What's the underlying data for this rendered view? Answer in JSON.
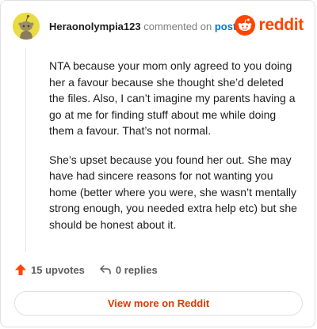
{
  "comment": {
    "username": "Heraonolympia123",
    "action_text": "commented on",
    "post_link": "post",
    "paragraphs": [
      "NTA because your mom only agreed to you doing her a favour because she thought she’d deleted the files. Also, I can’t imagine my parents having a go at me for finding stuff about me while doing them a favour. That’s not normal.",
      "She’s upset because you found her out. She may have had sincere reasons for not wanting you home (better where you were, she wasn’t mentally strong enough, you needed extra help etc) but she should be honest about it."
    ]
  },
  "brand": {
    "wordmark": "reddit",
    "color": "#ff4500"
  },
  "footer": {
    "upvotes": "15 upvotes",
    "replies": "0 replies",
    "upvote_icon": "upvote-arrow-icon",
    "reply_icon": "reply-arrow-icon"
  },
  "actions": {
    "view_more": "View more on Reddit"
  },
  "colors": {
    "accent": "#ff4500",
    "link": "#0079d3",
    "view_more_text": "#d93a00",
    "avatar_bg": "#e8db44"
  }
}
